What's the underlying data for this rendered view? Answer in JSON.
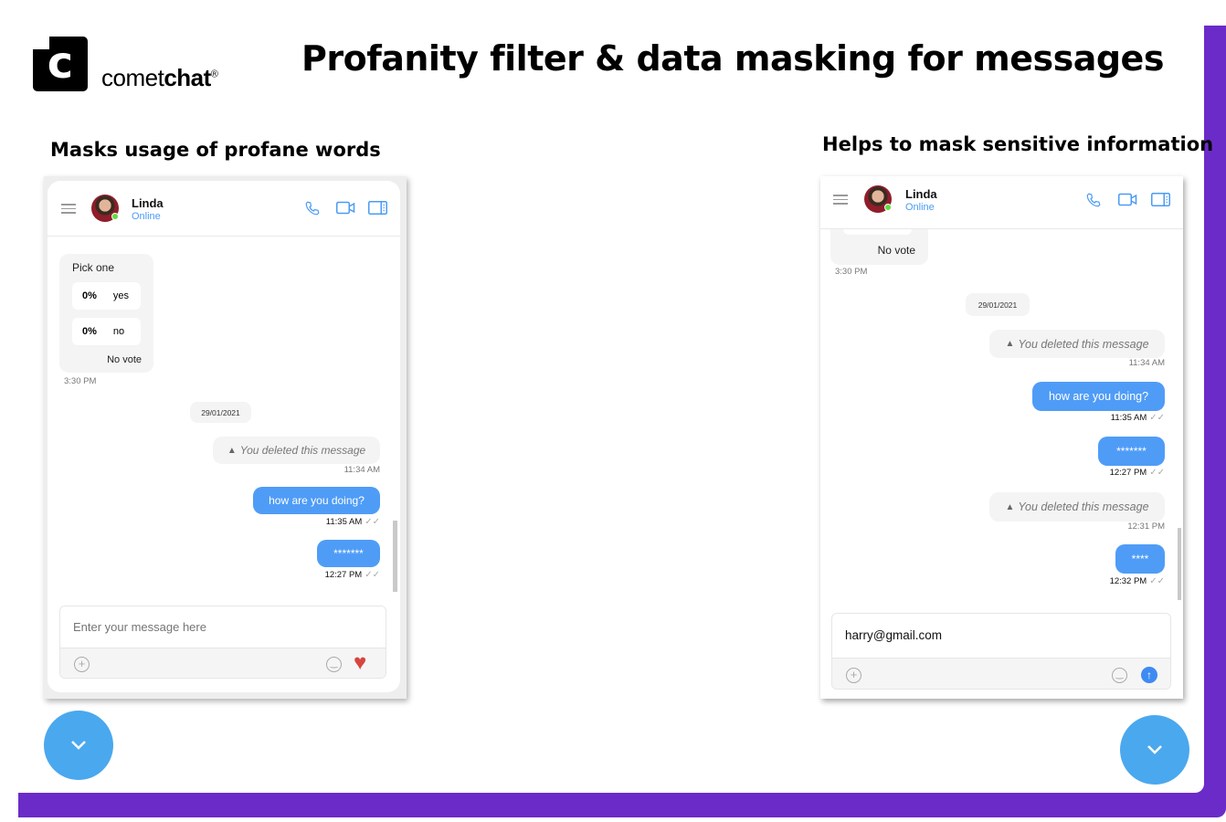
{
  "brand": {
    "name_light": "comet",
    "name_bold": "chat",
    "registered": "®",
    "logo_letter": "c"
  },
  "page_title": "Profanity filter & data masking for messages",
  "colors": {
    "accent_purple": "#6B2BC8",
    "bubble_blue": "#4f9cf7",
    "fab_blue": "#4AA8EE",
    "online_green": "#5fdc3c"
  },
  "left": {
    "caption": "Masks usage of profane words",
    "header": {
      "name": "Linda",
      "status": "Online"
    },
    "poll": {
      "question": "Pick one",
      "options": [
        {
          "percent": "0%",
          "label": "yes"
        },
        {
          "percent": "0%",
          "label": "no"
        }
      ],
      "footer": "No vote",
      "time": "3:30 PM"
    },
    "date": "29/01/2021",
    "messages": [
      {
        "type": "deleted",
        "text": "You deleted this message",
        "time": "11:34 AM"
      },
      {
        "type": "sent",
        "text": "how are you doing?",
        "time": "11:35 AM"
      },
      {
        "type": "sent",
        "text": "*******",
        "time": "12:27 PM"
      }
    ],
    "composer": {
      "placeholder": "Enter your message here",
      "value": ""
    }
  },
  "right": {
    "caption": "Helps to mask sensitive information",
    "header": {
      "name": "Linda",
      "status": "Online"
    },
    "poll": {
      "footer": "No vote",
      "time": "3:30 PM"
    },
    "date": "29/01/2021",
    "messages": [
      {
        "type": "deleted",
        "text": "You deleted this message",
        "time": "11:34 AM"
      },
      {
        "type": "sent",
        "text": "how are you doing?",
        "time": "11:35 AM"
      },
      {
        "type": "sent",
        "text": "*******",
        "time": "12:27 PM"
      },
      {
        "type": "deleted",
        "text": "You deleted this message",
        "time": "12:31 PM"
      },
      {
        "type": "sent",
        "text": "****",
        "time": "12:32 PM"
      }
    ],
    "composer": {
      "value": "harry@gmail.com"
    }
  },
  "icons": {
    "tick": "✓✓",
    "warning": "▲",
    "plus": "+",
    "down": "chevron-down-icon"
  }
}
